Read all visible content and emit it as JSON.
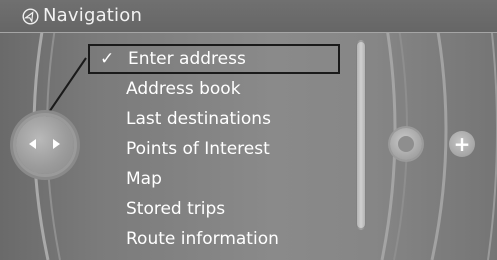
{
  "header": {
    "title": "Navigation",
    "icon": "navigation-icon"
  },
  "controller": {
    "icon": "controller-knob-icon"
  },
  "menu": {
    "selected_index": 0,
    "check_glyph": "✓",
    "items": [
      {
        "label": "Enter address"
      },
      {
        "label": "Address book"
      },
      {
        "label": "Last destinations"
      },
      {
        "label": "Points of Interest"
      },
      {
        "label": "Map"
      },
      {
        "label": "Stored trips"
      },
      {
        "label": "Route information"
      }
    ]
  },
  "right_panel": {
    "map_button_icon": "map-icon",
    "plus_label": "+"
  },
  "colors": {
    "background": "#7f7f7f",
    "text": "#ffffff",
    "highlight_border": "#1a1a1a"
  }
}
